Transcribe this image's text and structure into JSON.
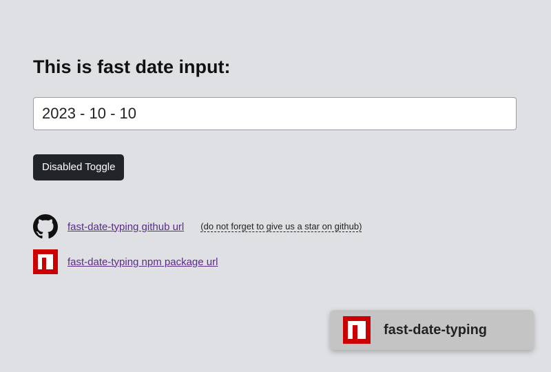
{
  "heading": "This is fast date input:",
  "date_input": {
    "value": "2023 - 10 - 10"
  },
  "toggle_button": "Disabled Toggle",
  "links": {
    "github": {
      "label": "fast-date-typing github url",
      "note": "(do not forget to give us a star on github)",
      "icon": "github-icon"
    },
    "npm": {
      "label": "fast-date-typing npm package url",
      "icon": "npm-icon"
    }
  },
  "badge": {
    "label": "fast-date-typing",
    "icon": "npm-icon"
  },
  "colors": {
    "background": "#dee0e4",
    "button_bg": "#212529",
    "link": "#5b2a86",
    "npm_red": "#cb0000",
    "badge_bg": "#c4c4c4"
  }
}
